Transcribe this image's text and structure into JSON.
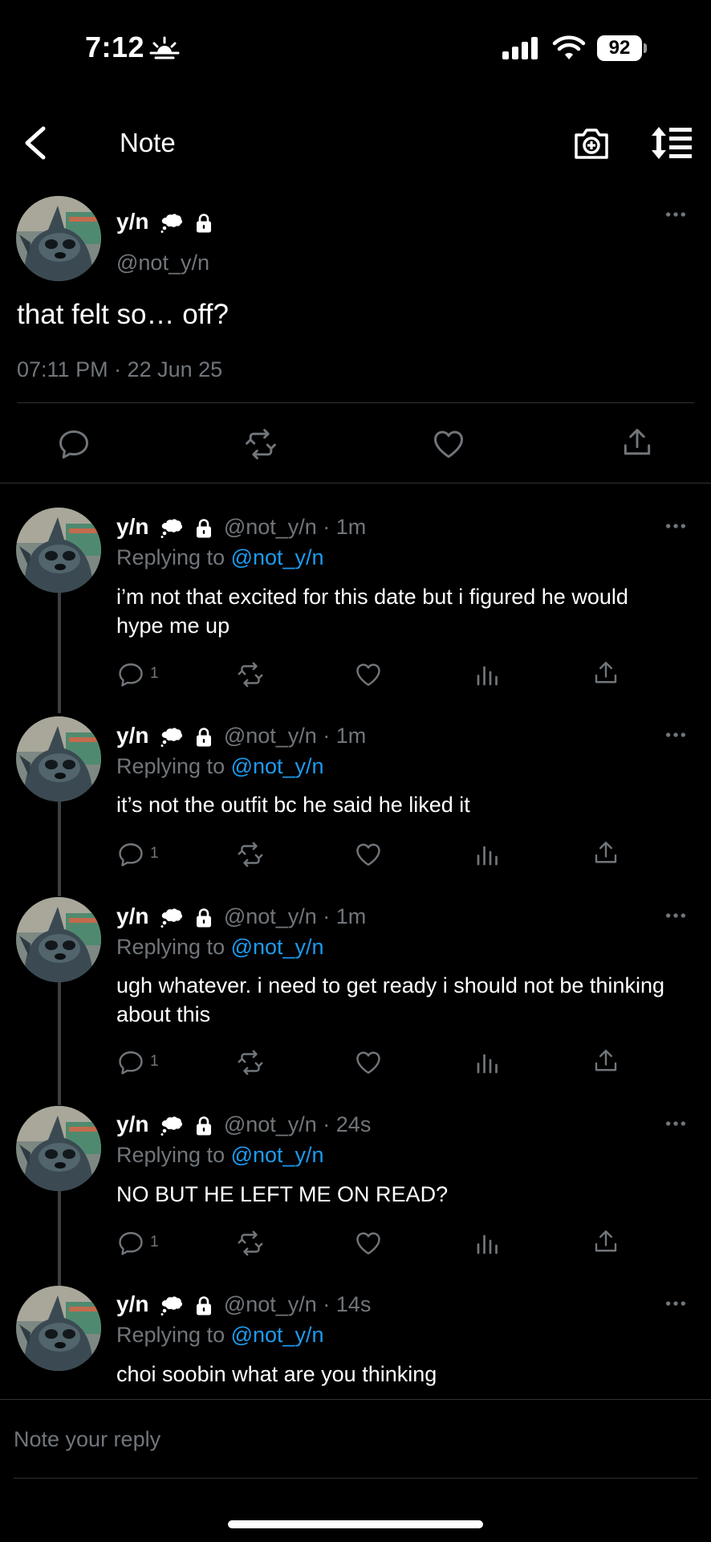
{
  "status_bar": {
    "time": "7:12",
    "battery": "92"
  },
  "header": {
    "title": "Note"
  },
  "note": {
    "name": "y/n",
    "handle": "@not_y/n",
    "text": "that felt so… off?",
    "timestamp": "07:11 PM · 22 Jun 25"
  },
  "replies": [
    {
      "name": "y/n",
      "meta": "@not_y/n · 1m",
      "replying_prefix": "Replying to ",
      "mention": "@not_y/n",
      "text": "i’m not that excited for this date but i figured he would hype me up",
      "reply_count": "1"
    },
    {
      "name": "y/n",
      "meta": "@not_y/n · 1m",
      "replying_prefix": "Replying to ",
      "mention": "@not_y/n",
      "text": "it’s not the outfit bc he said he liked it",
      "reply_count": "1"
    },
    {
      "name": "y/n",
      "meta": "@not_y/n · 1m",
      "replying_prefix": "Replying to ",
      "mention": "@not_y/n",
      "text": "ugh whatever. i need to get ready i should not be thinking about this",
      "reply_count": "1"
    },
    {
      "name": "y/n",
      "meta": "@not_y/n · 24s",
      "replying_prefix": "Replying to ",
      "mention": "@not_y/n",
      "text": "NO BUT HE LEFT ME ON READ?",
      "reply_count": "1"
    },
    {
      "name": "y/n",
      "meta": "@not_y/n · 14s",
      "replying_prefix": "Replying to ",
      "mention": "@not_y/n",
      "text": "choi soobin what are you thinking"
    }
  ],
  "composer": {
    "placeholder": "Note your reply"
  },
  "colors": {
    "accent": "#1d9bf0",
    "muted": "#71767b",
    "background": "#000000"
  },
  "icons": [
    "back-icon",
    "camera-add-icon",
    "sort-icon",
    "comment-icon",
    "retweet-icon",
    "like-icon",
    "views-icon",
    "share-icon",
    "more-icon",
    "thought-bubble-icon",
    "lock-icon"
  ]
}
